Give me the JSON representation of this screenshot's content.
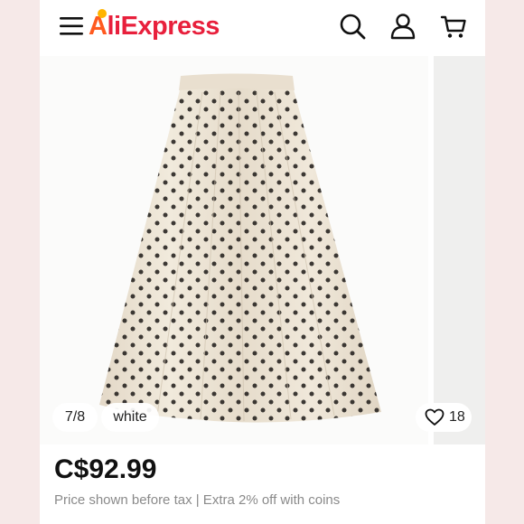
{
  "header": {
    "logo_first": "A",
    "logo_rest": "liExpress",
    "icons": [
      "menu-icon",
      "search-icon",
      "account-icon",
      "cart-icon"
    ]
  },
  "gallery": {
    "counter": "7/8",
    "selected_color": "white",
    "wishlist_count": "18",
    "icons": [
      "heart-icon"
    ]
  },
  "product": {
    "price": "C$92.99",
    "tax_note": "Price shown before tax | Extra 2% off with coins"
  },
  "colors": {
    "brand_red": "#e8203c",
    "brand_orange": "#ff5a1f",
    "logo_dot": "#ffb400",
    "side_background": "#f6e9e8",
    "skirt_fabric": "#ede4d6",
    "skirt_dots": "#1c1917"
  }
}
